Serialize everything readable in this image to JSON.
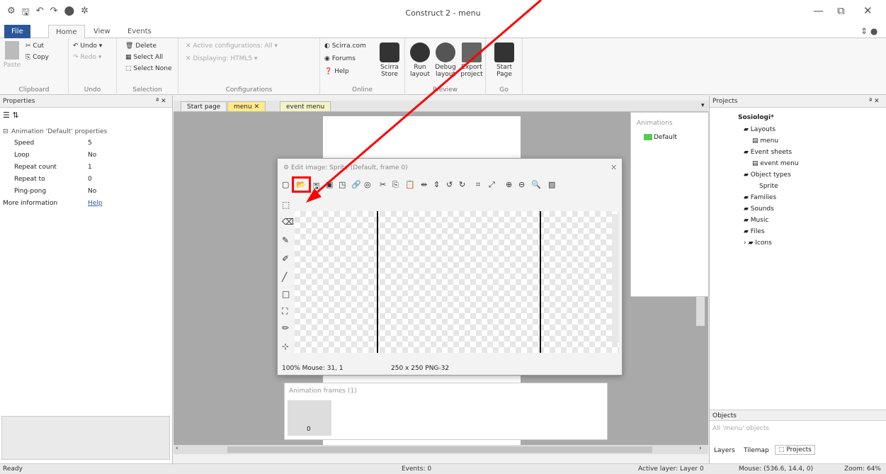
{
  "window": {
    "title": "Construct 2 - menu",
    "min": "—",
    "restore": "⧉",
    "close": "✕"
  },
  "qat": [
    "⚙",
    "🖫",
    "↶",
    "↷",
    "⬤",
    "✲"
  ],
  "tabs": [
    "File",
    "Home",
    "View",
    "Events"
  ],
  "ribbon": {
    "clipboard": {
      "paste": "Paste",
      "cut": "Cut",
      "copy": "Copy",
      "label": "Clipboard"
    },
    "undo": {
      "undo": "Undo",
      "redo": "Redo",
      "label": "Undo"
    },
    "selection": {
      "delete": "Delete",
      "select_all": "Select All",
      "select_none": "Select None",
      "label": "Selection"
    },
    "config": {
      "active": "Active configurations: All",
      "displaying": "Displaying: HTML5",
      "label": "Configurations"
    },
    "online": {
      "scirra": "Scirra.com",
      "forums": "Forums",
      "help": "Help",
      "store": "Scirra Store",
      "label": "Online"
    },
    "preview": {
      "run": "Run layout",
      "debug": "Debug layout",
      "export": "Export project",
      "label": "Preview"
    },
    "go": {
      "start": "Start Page",
      "label": "Go"
    }
  },
  "properties": {
    "title": "Properties",
    "section": "Animation 'Default' properties",
    "rows": [
      [
        "Speed",
        "5"
      ],
      [
        "Loop",
        "No"
      ],
      [
        "Repeat count",
        "1"
      ],
      [
        "Repeat to",
        "0"
      ],
      [
        "Ping-pong",
        "No"
      ],
      [
        "More information",
        "Help"
      ]
    ]
  },
  "doc_tabs": [
    "Start page",
    "menu",
    "event menu"
  ],
  "animations": {
    "title": "Animations",
    "item": "Default"
  },
  "editor": {
    "title": "Edit image: Sprite (Default, frame 0)",
    "status_zoom": "100%",
    "status_mouse": "Mouse: 31, 1",
    "status_size": "250 x 250  PNG-32"
  },
  "frames": {
    "title": "Animation frames (1)",
    "frame_index": "0"
  },
  "projects": {
    "title": "Projects",
    "tree": [
      "Sosiologi*",
      "Layouts",
      "menu",
      "Event sheets",
      "event menu",
      "Object types",
      "Sprite",
      "Families",
      "Sounds",
      "Music",
      "Files",
      "Icons"
    ]
  },
  "objects": {
    "title": "Objects",
    "filter": "All 'menu' objects"
  },
  "bottom_tabs": [
    "Layers",
    "Tilemap",
    "Projects"
  ],
  "status": {
    "ready": "Ready",
    "events": "Events: 0",
    "layer": "Active layer: Layer 0",
    "mouse": "Mouse: (536.6, 14.4, 0)",
    "zoom": "Zoom: 64%"
  },
  "accent": "#2b579a",
  "highlight": "#ff0000"
}
